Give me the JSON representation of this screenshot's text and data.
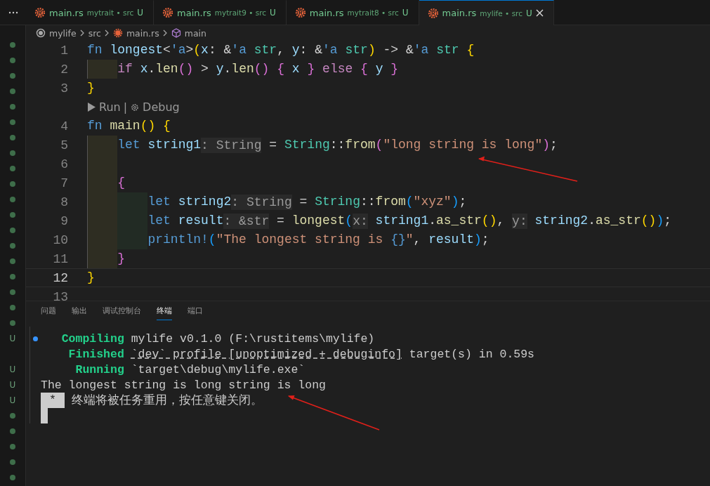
{
  "tabs": [
    {
      "name": "main.rs",
      "path": "mytrait • src",
      "status": "U",
      "selected": false
    },
    {
      "name": "main.rs",
      "path": "mytrait9 • src",
      "status": "U",
      "selected": false
    },
    {
      "name": "main.rs",
      "path": "mytrait8 • src",
      "status": "U",
      "selected": false
    },
    {
      "name": "main.rs",
      "path": "mylife • src",
      "status": "U",
      "selected": true
    }
  ],
  "breadcrumb": [
    {
      "label": "mylife",
      "kind": "root"
    },
    {
      "label": "src",
      "kind": "folder"
    },
    {
      "label": "main.rs",
      "kind": "file"
    },
    {
      "label": "main",
      "kind": "symbol"
    }
  ],
  "side_markers": [
    {
      "kind": "dot"
    },
    {
      "kind": "dot"
    },
    {
      "kind": "dot"
    },
    {
      "kind": "dot"
    },
    {
      "kind": "dot"
    },
    {
      "kind": "dot"
    },
    {
      "kind": "dot"
    },
    {
      "kind": "dot"
    },
    {
      "kind": "dot"
    },
    {
      "kind": "dot"
    },
    {
      "kind": "dot"
    },
    {
      "kind": "dot"
    },
    {
      "kind": "dot"
    },
    {
      "kind": "dot"
    },
    {
      "kind": "dot"
    },
    {
      "kind": "dot"
    },
    {
      "kind": "dot"
    },
    {
      "kind": "dot"
    },
    {
      "kind": "dot"
    },
    {
      "kind": "status",
      "text": "U"
    },
    {
      "kind": "blank"
    },
    {
      "kind": "status",
      "text": "U"
    },
    {
      "kind": "status",
      "text": "U"
    },
    {
      "kind": "status",
      "text": "U"
    },
    {
      "kind": "dot"
    },
    {
      "kind": "dot"
    },
    {
      "kind": "dot"
    },
    {
      "kind": "dot"
    },
    {
      "kind": "dot"
    }
  ],
  "editor": {
    "lines": [
      {
        "kind": "code",
        "number": "1",
        "current": false,
        "segments": [
          {
            "kind": "code",
            "text": "fn longest<'a>(x: &'a str, y: &'a str) -> &'a str {"
          }
        ]
      },
      {
        "kind": "code",
        "number": "2",
        "current": false,
        "segments": [
          {
            "kind": "code",
            "text": "    if x.len() > y.len() { x } else { y }"
          }
        ]
      },
      {
        "kind": "code",
        "number": "3",
        "current": false,
        "segments": [
          {
            "kind": "code",
            "text": "}"
          }
        ]
      },
      {
        "kind": "codelens",
        "run": "Run",
        "separator": "|",
        "debug": "Debug"
      },
      {
        "kind": "code",
        "number": "4",
        "current": false,
        "segments": [
          {
            "kind": "code",
            "text": "fn main() {"
          }
        ]
      },
      {
        "kind": "code",
        "number": "5",
        "current": false,
        "segments": [
          {
            "kind": "code",
            "text": "    let string1"
          },
          {
            "kind": "hint",
            "text": ": String"
          },
          {
            "kind": "code",
            "text": " = String::from(\"long string is long\");"
          }
        ]
      },
      {
        "kind": "code",
        "number": "6",
        "current": false,
        "indent_guide": true
      },
      {
        "kind": "code",
        "number": "7",
        "current": false,
        "segments": [
          {
            "kind": "code",
            "text": "    {"
          }
        ]
      },
      {
        "kind": "code",
        "number": "8",
        "current": false,
        "segments": [
          {
            "kind": "code",
            "text": "        let string2"
          },
          {
            "kind": "hint",
            "text": ": String"
          },
          {
            "kind": "code",
            "text": " = String::from(\"xyz\");"
          }
        ]
      },
      {
        "kind": "code",
        "number": "9",
        "current": false,
        "segments": [
          {
            "kind": "code",
            "text": "        let result"
          },
          {
            "kind": "hint",
            "text": ": &str"
          },
          {
            "kind": "code",
            "text": " = longest("
          },
          {
            "kind": "hint",
            "text": "x:"
          },
          {
            "kind": "code",
            "text": " string1.as_str(), "
          },
          {
            "kind": "hint",
            "text": "y:"
          },
          {
            "kind": "code",
            "text": " string2.as_str());"
          }
        ]
      },
      {
        "kind": "code",
        "number": "10",
        "current": false,
        "segments": [
          {
            "kind": "code",
            "text": "        println!(\"The longest string is {}\", result);"
          }
        ]
      },
      {
        "kind": "code",
        "number": "11",
        "current": false,
        "segments": [
          {
            "kind": "code",
            "text": "    }"
          }
        ]
      },
      {
        "kind": "code",
        "number": "12",
        "current": true,
        "segments": [
          {
            "kind": "code",
            "text": "}"
          }
        ]
      },
      {
        "kind": "code",
        "number": "13",
        "current": false
      }
    ]
  },
  "panel": {
    "tabs": [
      {
        "label": "问题",
        "selected": false
      },
      {
        "label": "输出",
        "selected": false
      },
      {
        "label": "调试控制台",
        "selected": false
      },
      {
        "label": "终端",
        "selected": true
      },
      {
        "label": "端口",
        "selected": false
      }
    ],
    "terminal": [
      {
        "kind": "status",
        "label": "Compiling",
        "text": "mylife v0.1.0 (F:\\rustitems\\mylife)",
        "marker": true
      },
      {
        "kind": "status",
        "label": "Finished",
        "link": "`dev` profile [unoptimized + debuginfo]",
        "text": " target(s) in 0.59s",
        "marker": false
      },
      {
        "kind": "status",
        "label": "Running",
        "text": "`target\\debug\\mylife.exe`",
        "marker": false
      },
      {
        "kind": "plain",
        "text": "The longest string is long string is long"
      },
      {
        "kind": "task",
        "badge": "*",
        "text": "终端将被任务重用，按任意键关闭。"
      }
    ]
  }
}
